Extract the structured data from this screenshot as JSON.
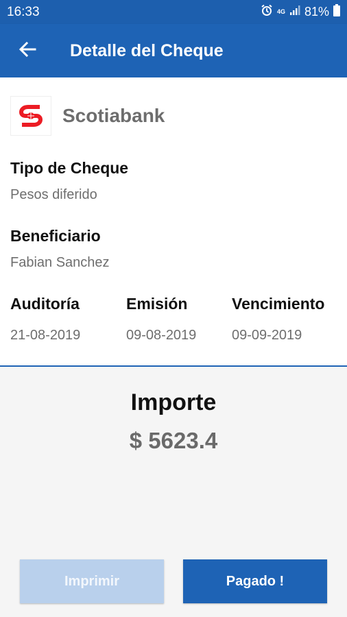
{
  "status_bar": {
    "time": "16:33",
    "network": "4G",
    "battery": "81%",
    "icons": [
      "alarm-icon",
      "network-4g-icon",
      "signal-icon",
      "battery-icon"
    ]
  },
  "app_bar": {
    "title": "Detalle del Cheque",
    "back_icon": "arrow-left-icon"
  },
  "bank": {
    "name": "Scotiabank",
    "logo_icon": "scotiabank-logo"
  },
  "cheque": {
    "tipo_label": "Tipo de Cheque",
    "tipo_value": "Pesos diferido",
    "beneficiario_label": "Beneficiario",
    "beneficiario_value": "Fabian Sanchez",
    "auditoria_label": "Auditoría",
    "auditoria_value": "21-08-2019",
    "emision_label": "Emisión",
    "emision_value": "09-08-2019",
    "vencimiento_label": "Vencimiento",
    "vencimiento_value": "09-09-2019"
  },
  "importe": {
    "label": "Importe",
    "value": "$ 5623.4"
  },
  "buttons": {
    "print_label": "Imprimir",
    "paid_label": "Pagado !"
  },
  "colors": {
    "primary": "#1e63b5",
    "status_bar": "#1d5fae",
    "disabled_button": "#b9d0ec",
    "brand_red": "#ec1c24"
  }
}
